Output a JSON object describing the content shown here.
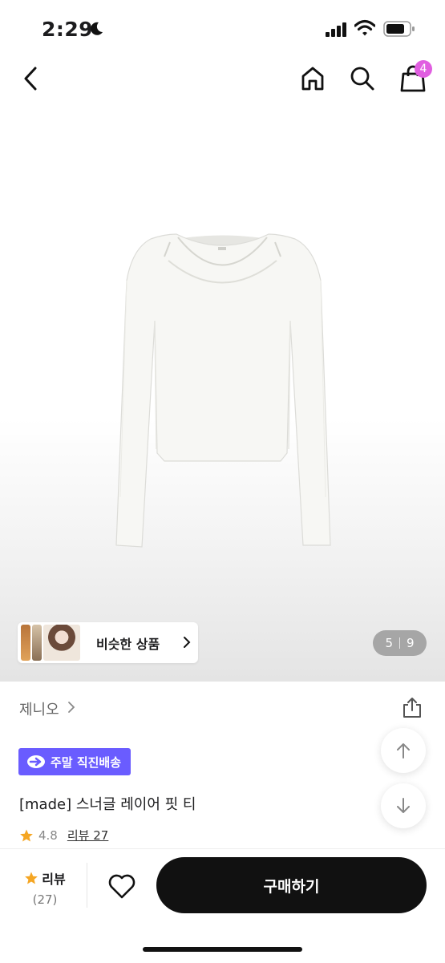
{
  "status": {
    "time": "2:29"
  },
  "header": {
    "cart_count": "4"
  },
  "gallery": {
    "similar_label": "비슷한 상품",
    "current_page": "5",
    "total_pages": "9"
  },
  "product": {
    "brand": "제니오",
    "badge": "주말 직진배송",
    "title": "[made] 스너글 레이어 핏 티",
    "rating": "4.8",
    "review_link": "리뷰 27"
  },
  "bottom_bar": {
    "review_label": "리뷰",
    "review_count": "(27)",
    "buy_label": "구매하기"
  },
  "colors": {
    "badge_bg": "#6a5cff",
    "cart_badge": "#e05ee0",
    "star": "#f5a623",
    "buy_bg": "#111111"
  }
}
